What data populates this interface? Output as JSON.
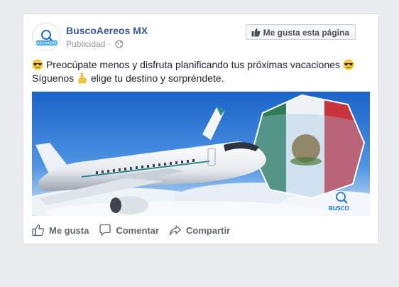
{
  "post": {
    "page_name": "BuscoAereos MX",
    "sponsored_label": "Publicidad",
    "separator": "·",
    "like_page_button": "Me gusta esta página",
    "text_line1": " Preocúpate menos y disfruta planificando tus próximas vacaciones ",
    "text_line2_a": "Síguenos ",
    "text_line2_b": " elige tu destino y sorpréndete.",
    "avatar_logo_text": "BUSCOAEREO",
    "image_watermark": "BUSCO"
  },
  "actions": {
    "like": "Me gusta",
    "comment": "Comentar",
    "share": "Compartir"
  },
  "colors": {
    "page_background": "#e9ebee",
    "link_blue": "#365899",
    "action_gray": "#606770",
    "sky_blue": "#1f6fd6"
  },
  "icons": {
    "globe": "globe-icon",
    "thumbs_up": "thumbs-up-icon",
    "comment": "comment-icon",
    "share": "share-icon",
    "sunglasses": "sunglasses-emoji-icon",
    "pointing_hand": "pointing-hand-emoji-icon"
  }
}
